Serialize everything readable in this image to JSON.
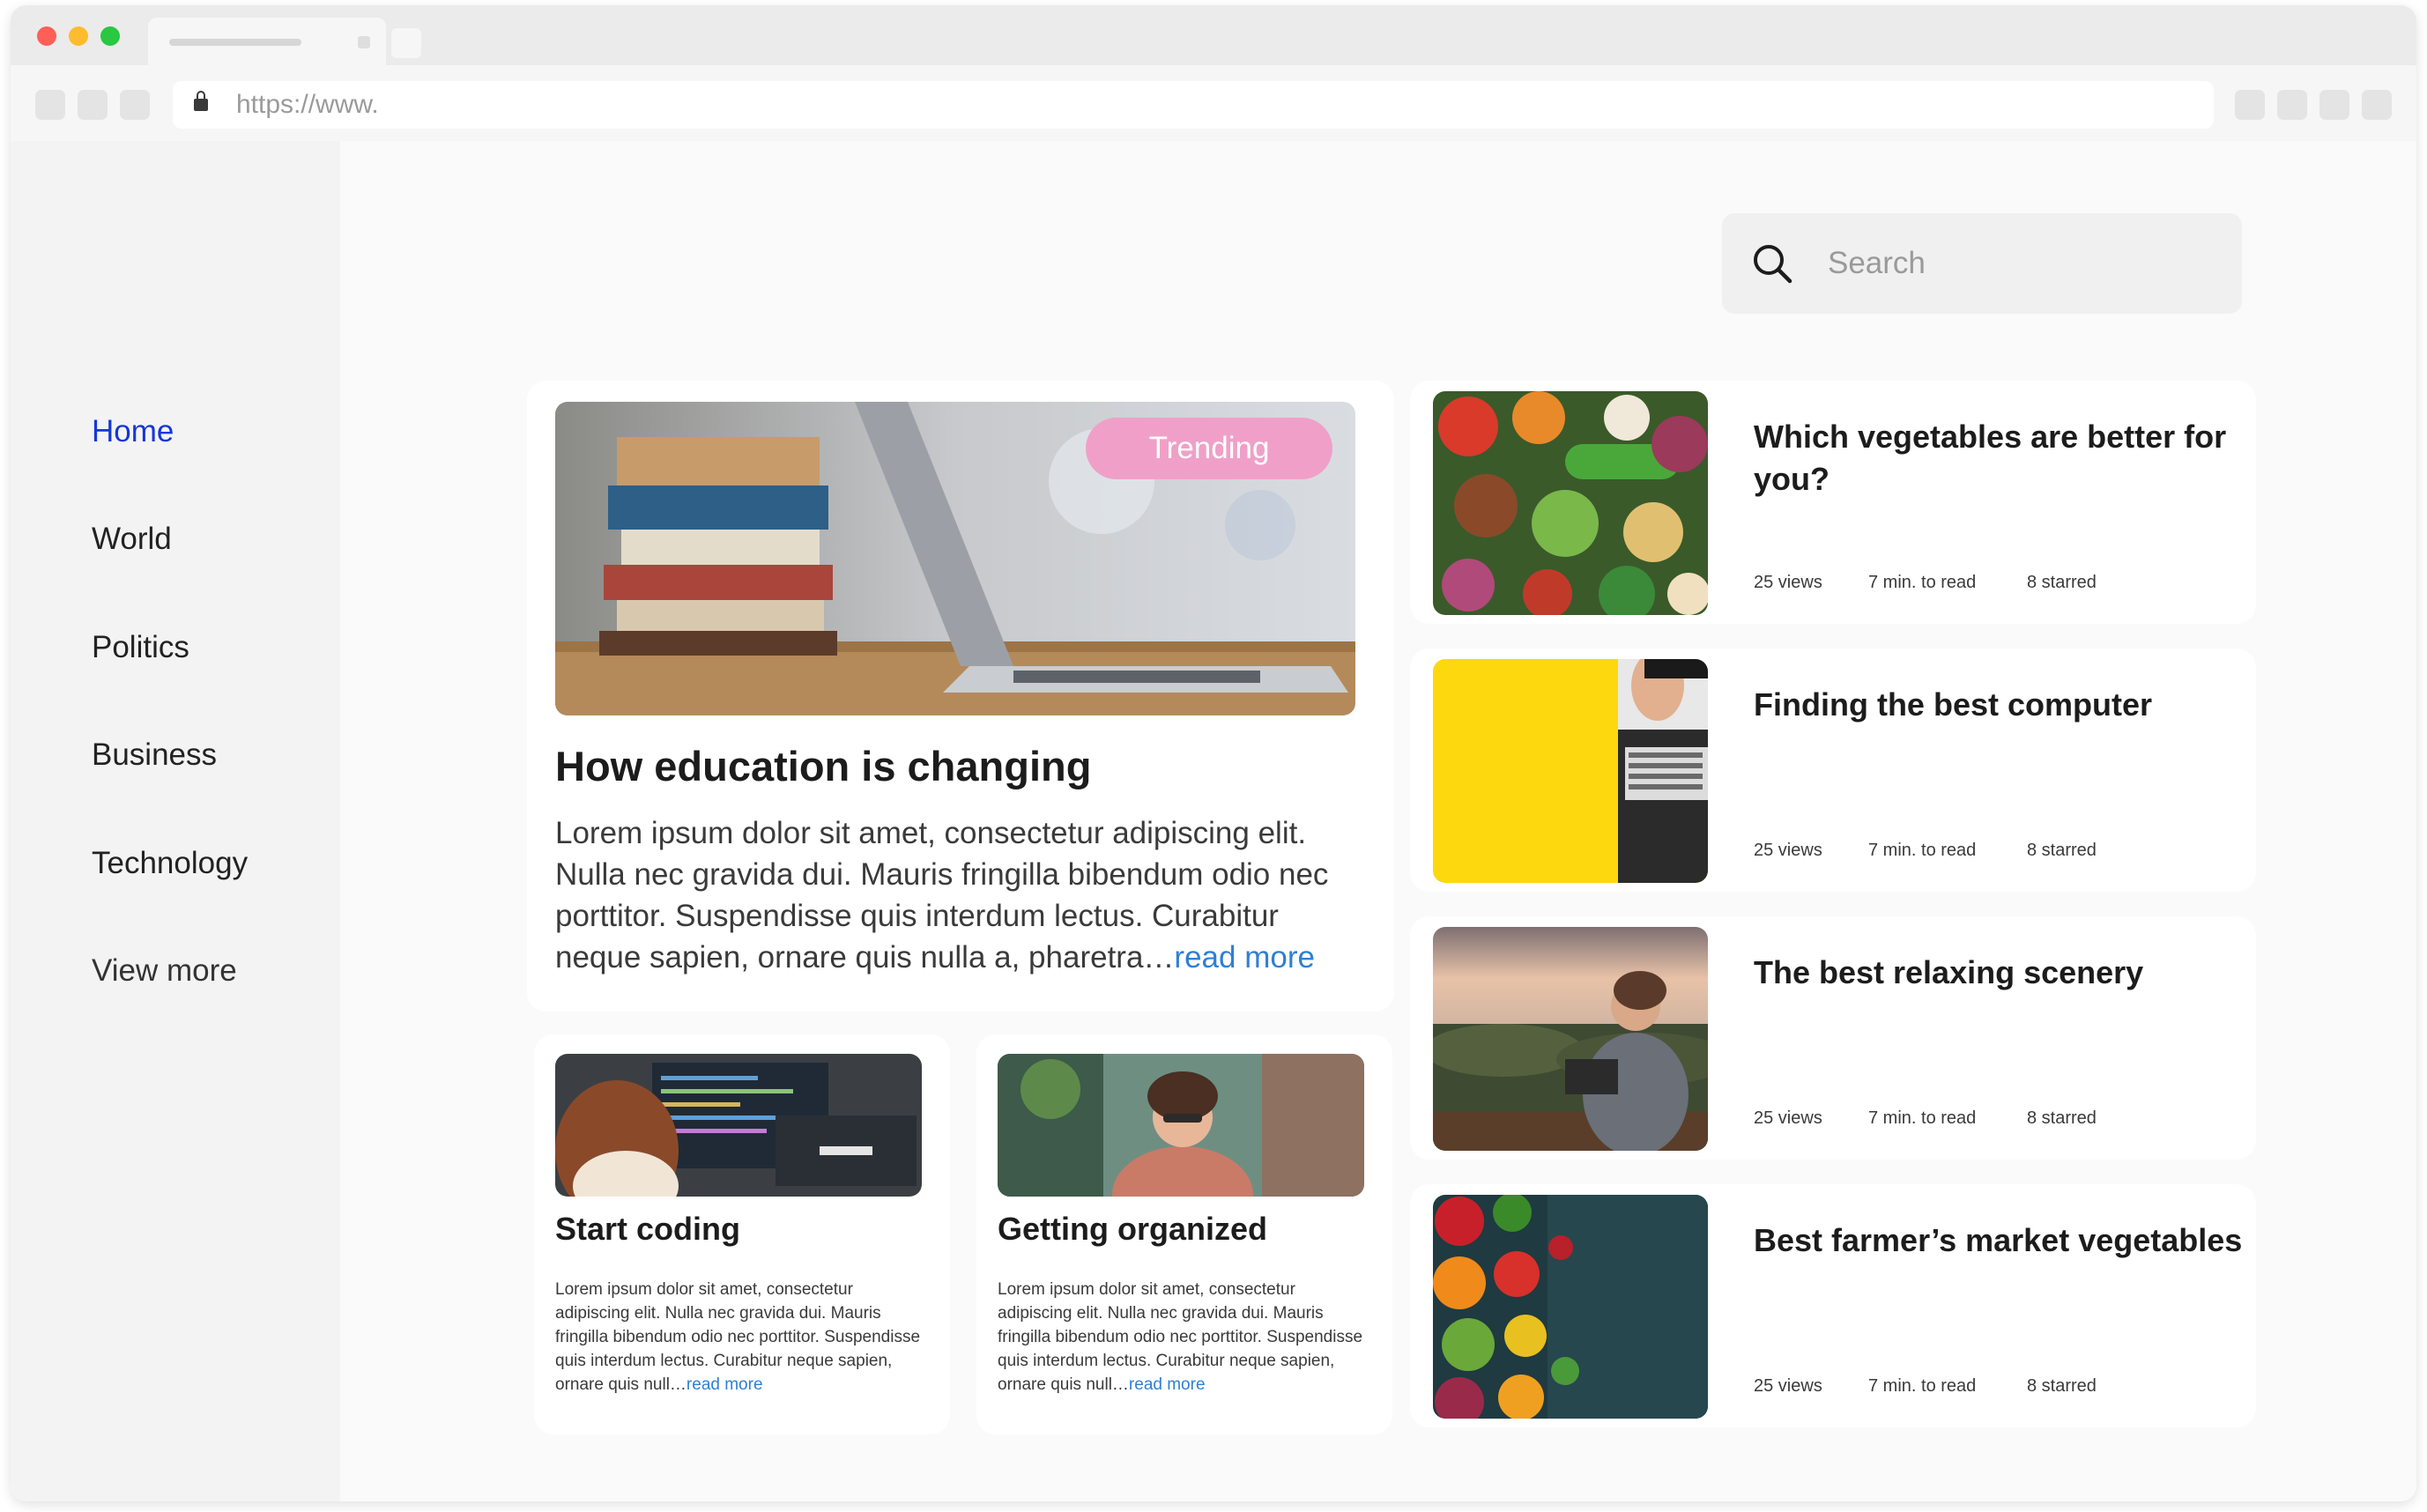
{
  "browser": {
    "url": "https://www."
  },
  "sidebar": {
    "items": [
      {
        "label": "Home",
        "active": true
      },
      {
        "label": "World"
      },
      {
        "label": "Politics"
      },
      {
        "label": "Business"
      },
      {
        "label": "Technology"
      },
      {
        "label": "View more"
      }
    ]
  },
  "search": {
    "placeholder": "Search"
  },
  "featured": {
    "badge": "Trending",
    "title": "How education is changing",
    "body": "Lorem ipsum dolor sit amet, consectetur adipiscing elit. Nulla nec gravida dui. Mauris fringilla bibendum odio nec porttitor. Suspendisse quis interdum lectus. Curabitur neque sapien, ornare quis nulla a, pharetra…",
    "read_more": "read more"
  },
  "small_cards": [
    {
      "title": "Start coding",
      "body": "Lorem ipsum dolor sit amet, consectetur adipiscing elit. Nulla nec gravida dui. Mauris fringilla bibendum odio nec porttitor. Suspendisse quis interdum lectus. Curabitur neque sapien, ornare quis null…",
      "read_more": "read more"
    },
    {
      "title": "Getting organized",
      "body": "Lorem ipsum dolor sit amet, consectetur adipiscing elit. Nulla nec gravida dui. Mauris fringilla bibendum odio nec porttitor. Suspendisse quis interdum lectus. Curabitur neque sapien, ornare quis null…",
      "read_more": "read more"
    }
  ],
  "articles": [
    {
      "title": "Which vegetables are better for you?",
      "views": "25 views",
      "read_time": "7 min. to read",
      "starred": "8 starred"
    },
    {
      "title": "Finding the best computer",
      "views": "25 views",
      "read_time": "7 min. to read",
      "starred": "8 starred"
    },
    {
      "title": "The best relaxing scenery",
      "views": "25 views",
      "read_time": "7 min. to read",
      "starred": "8 starred"
    },
    {
      "title": "Best farmer’s market vegetables",
      "views": "25 views",
      "read_time": "7 min. to read",
      "starred": "8 starred"
    }
  ],
  "colors": {
    "nav_active": "#1437d8",
    "link": "#2f7fd4",
    "badge": "#f0a0c8"
  }
}
